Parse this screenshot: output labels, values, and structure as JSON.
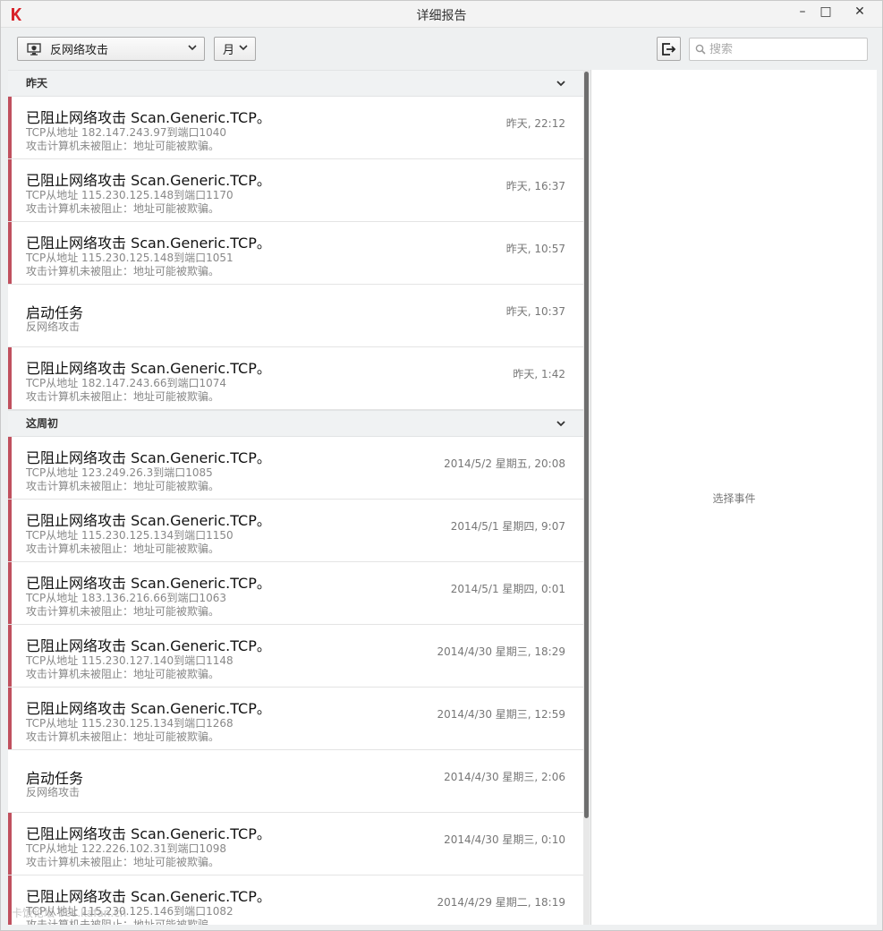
{
  "window": {
    "title": "详细报告",
    "minimize": "–",
    "maximize": "□",
    "close": "✕"
  },
  "toolbar": {
    "event_type": "反网络攻击",
    "period": "月",
    "search_placeholder": "搜索"
  },
  "groups": [
    {
      "label": "昨天",
      "events": [
        {
          "kind": "alert",
          "title": "已阻止网络攻击 Scan.Generic.TCP。",
          "line1": "TCP从地址 182.147.243.97到端口1040",
          "line2": "攻击计算机未被阻止：地址可能被欺骗。",
          "time": "昨天, 22:12"
        },
        {
          "kind": "alert",
          "title": "已阻止网络攻击 Scan.Generic.TCP。",
          "line1": "TCP从地址 115.230.125.148到端口1170",
          "line2": "攻击计算机未被阻止：地址可能被欺骗。",
          "time": "昨天, 16:37"
        },
        {
          "kind": "alert",
          "title": "已阻止网络攻击 Scan.Generic.TCP。",
          "line1": "TCP从地址 115.230.125.148到端口1051",
          "line2": "攻击计算机未被阻止：地址可能被欺骗。",
          "time": "昨天, 10:57"
        },
        {
          "kind": "task",
          "title": "启动任务",
          "line1": "反网络攻击",
          "line2": "",
          "time": "昨天, 10:37"
        },
        {
          "kind": "alert",
          "title": "已阻止网络攻击 Scan.Generic.TCP。",
          "line1": "TCP从地址 182.147.243.66到端口1074",
          "line2": "攻击计算机未被阻止：地址可能被欺骗。",
          "time": "昨天, 1:42"
        }
      ]
    },
    {
      "label": "这周初",
      "events": [
        {
          "kind": "alert",
          "title": "已阻止网络攻击 Scan.Generic.TCP。",
          "line1": "TCP从地址 123.249.26.3到端口1085",
          "line2": "攻击计算机未被阻止：地址可能被欺骗。",
          "time": "2014/5/2 星期五, 20:08"
        },
        {
          "kind": "alert",
          "title": "已阻止网络攻击 Scan.Generic.TCP。",
          "line1": "TCP从地址 115.230.125.134到端口1150",
          "line2": "攻击计算机未被阻止：地址可能被欺骗。",
          "time": "2014/5/1 星期四, 9:07"
        },
        {
          "kind": "alert",
          "title": "已阻止网络攻击 Scan.Generic.TCP。",
          "line1": "TCP从地址 183.136.216.66到端口1063",
          "line2": "攻击计算机未被阻止：地址可能被欺骗。",
          "time": "2014/5/1 星期四, 0:01"
        },
        {
          "kind": "alert",
          "title": "已阻止网络攻击 Scan.Generic.TCP。",
          "line1": "TCP从地址 115.230.127.140到端口1148",
          "line2": "攻击计算机未被阻止：地址可能被欺骗。",
          "time": "2014/4/30 星期三, 18:29"
        },
        {
          "kind": "alert",
          "title": "已阻止网络攻击 Scan.Generic.TCP。",
          "line1": "TCP从地址 115.230.125.134到端口1268",
          "line2": "攻击计算机未被阻止：地址可能被欺骗。",
          "time": "2014/4/30 星期三, 12:59"
        },
        {
          "kind": "task",
          "title": "启动任务",
          "line1": "反网络攻击",
          "line2": "",
          "time": "2014/4/30 星期三, 2:06"
        },
        {
          "kind": "alert",
          "title": "已阻止网络攻击 Scan.Generic.TCP。",
          "line1": "TCP从地址 122.226.102.31到端口1098",
          "line2": "攻击计算机未被阻止：地址可能被欺骗。",
          "time": "2014/4/30 星期三, 0:10"
        },
        {
          "kind": "alert",
          "title": "已阻止网络攻击 Scan.Generic.TCP。",
          "line1": "TCP从地址 115.230.125.146到端口1082",
          "line2": "攻击计算机未被阻止：地址可能被欺骗。",
          "time": "2014/4/29 星期二, 18:19"
        }
      ]
    }
  ],
  "detail": {
    "empty_text": "选择事件"
  },
  "watermark": "卡饭论坛 bbs.kafan.cn",
  "colors": {
    "alert_stripe": "#c0505e",
    "logo_red": "#d8232a"
  }
}
